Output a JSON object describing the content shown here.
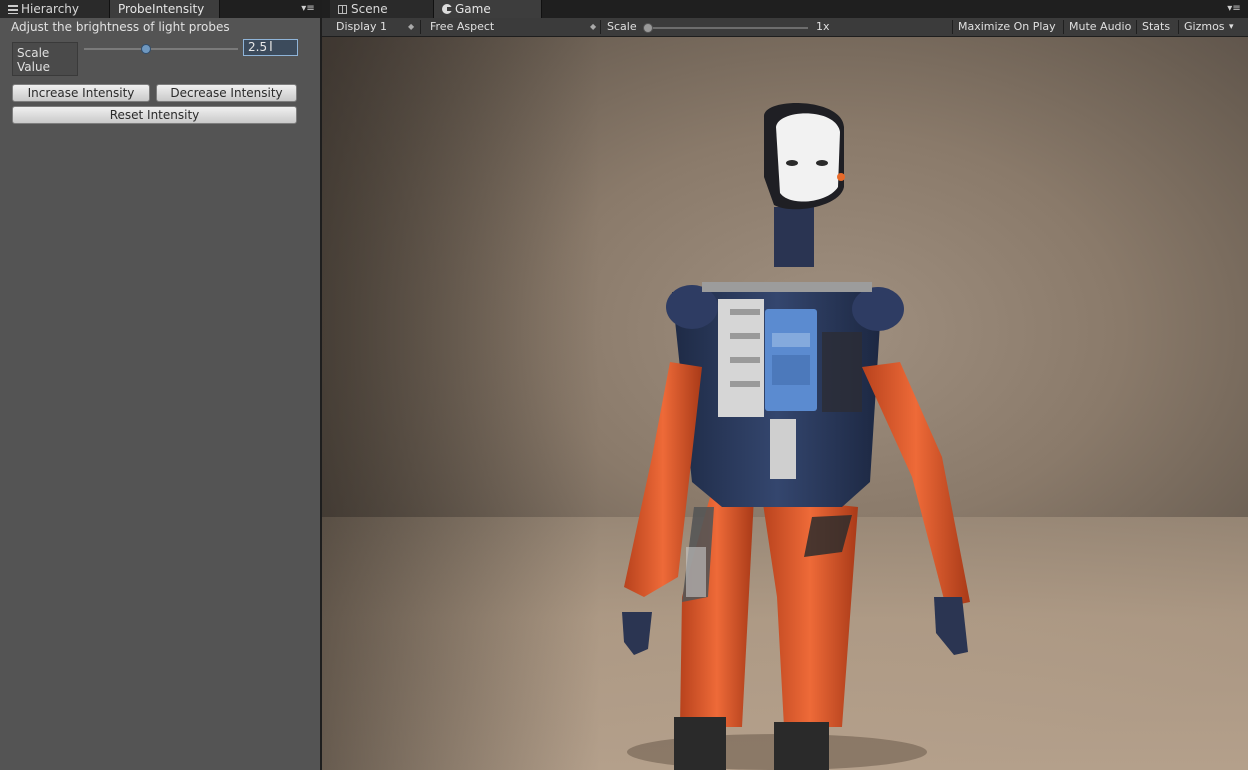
{
  "left_panel": {
    "tabs": [
      {
        "label": "Hierarchy",
        "active": false
      },
      {
        "label": "ProbeIntensity",
        "active": true
      }
    ],
    "description": "Adjust the brightness of light probes",
    "scale_label": "Scale Value",
    "scale_value": "2.5",
    "slider_fraction": 0.4,
    "buttons": {
      "increase": "Increase Intensity",
      "decrease": "Decrease Intensity",
      "reset": "Reset Intensity"
    }
  },
  "game_view": {
    "tabs": [
      {
        "label": "Scene",
        "active": false
      },
      {
        "label": "Game",
        "active": true
      }
    ],
    "toolbar": {
      "display": "Display 1",
      "aspect": "Free Aspect",
      "scale_label": "Scale",
      "scale_value": "1x",
      "maximize": "Maximize On Play",
      "mute": "Mute Audio",
      "stats": "Stats",
      "gizmos": "Gizmos"
    }
  },
  "colors": {
    "panel_bg": "#545454",
    "suit_orange": "#e0552a",
    "suit_navy": "#2b3a5c",
    "chest_panel_blue": "#5b8bd0"
  }
}
